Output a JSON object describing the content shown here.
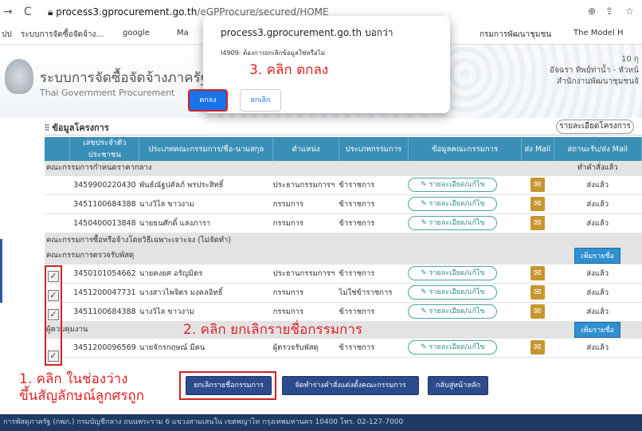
{
  "browser": {
    "url_host": "process3.gprocurement.go.th",
    "url_path": "/eGPProcure/secured/HOME",
    "bookmarks": [
      "ระบบการจัดซื้อจัดจ้าง...",
      "google",
      "Ma",
      "กรมการพัฒนาชุมชน",
      "The Model H"
    ]
  },
  "dialog": {
    "host": "process3.gprocurement.go.th บอกว่า",
    "message": "I4909: ต้องการยกเลิกข้อมูลใช่หรือไม่",
    "ok_label": "ตกลง",
    "cancel_label": "ยกเลิก"
  },
  "header": {
    "title": "ระบบการจัดซื้อจัดจ้างภาครัฐ",
    "subtitle": "Thai Government Procurement",
    "date": "10 กุ",
    "user": "อัจฉรา ทิพย์ท่าน้ำ - หัวหน้",
    "org": "สำนักงานพัฒนาชุมชนจั"
  },
  "panel": {
    "title": "ข้อมูลโครงการ",
    "dropdown": "รายละเอียดโครงการ ▾"
  },
  "table": {
    "headers": [
      "",
      "เลขประจำตัวประชาชน",
      "ประเภทคณะกรรมการ/ชื่อ-นามสกุล",
      "ตำแหน่ง",
      "ประเภทกรรมการ",
      "ข้อมูลคณะกรรมการ",
      "ส่ง Mail",
      "สถานะรับ/ส่ง Mail"
    ],
    "cat1": "คณะกรรมการกำหนดราคากลาง",
    "cat1_status": "ทำคำสั่งแล้ว",
    "cat2": "คณะกรรมการซื้อหรือจ้างโดยวิธีเฉพาะเจาะจง (ไม่จัดทำ)",
    "cat3": "คณะกรรมการตรวจรับพัสดุ",
    "cat4": "ผู้ควบคุมงาน",
    "add_label": "เพิ่มรายชื่อ",
    "detail_label": "รายละเอียด/แก้ไข",
    "rows1": [
      {
        "id": "3459900220430",
        "name": "พันธ์ณัฐปคัลภ์ พรประสิทธิ์",
        "pos": "ประธานกรรมการฯ",
        "type": "ข้าราชการ",
        "status": "ส่งแล้ว"
      },
      {
        "id": "3451100684388",
        "name": "นางวิไล ขาวงาม",
        "pos": "กรรมการ",
        "type": "ข้าราชการ",
        "status": "ส่งแล้ว"
      },
      {
        "id": "1450400013848",
        "name": "นายธนศักดิ์ แสงภารา",
        "pos": "กรรมการ",
        "type": "ข้าราชการ",
        "status": "ส่งแล้ว"
      }
    ],
    "rows3": [
      {
        "id": "3450101054662",
        "name": "นายคงยศ อรัญมิตร",
        "pos": "ประธานกรรมการฯ",
        "type": "ข้าราชการ",
        "status": "ส่งแล้ว"
      },
      {
        "id": "1451200047731",
        "name": "นางสาวไพจิตร มงคลอิทธิ์",
        "pos": "กรรมการ",
        "type": "ไม่ใช่ข้าราชการ",
        "status": "ส่งแล้ว"
      },
      {
        "id": "3451100684388",
        "name": "นางวิไล ขาวงาม",
        "pos": "กรรมการ",
        "type": "ข้าราชการ",
        "status": "ส่งแล้ว"
      }
    ],
    "rows4": [
      {
        "id": "3451200096569",
        "name": "นายจักรกฤษณ์ มีคน",
        "pos": "ผู้ตรวจรับพัสดุ",
        "type": "ข้าราชการ",
        "status": "ส่งแล้ว"
      }
    ]
  },
  "buttons": {
    "remove": "ยกเลิกรายชื่อกรรมการ",
    "create_order": "จัดทำร่างคำสั่งแต่งตั้งคณะกรรมการ",
    "home": "กลับสู่หน้าหลัก"
  },
  "annotations": {
    "step1_line1": "1. คลิก ในช่องว่าง",
    "step1_line2": "ขึ้นสัญลักษณ์ลูกศรถูก",
    "step2": "2. คลิก ยกเลิกรายชื่อกรรมการ",
    "step3": "3. คลิก ตกลง"
  },
  "footer": "การพัสดุภาครัฐ (กพภ.) กรมบัญชีกลาง ถนนพระราม 6 แขวงสามเสนใน เขตพญาไท กรุงเทพมหานคร 10400 โทร. 02-127-7000"
}
